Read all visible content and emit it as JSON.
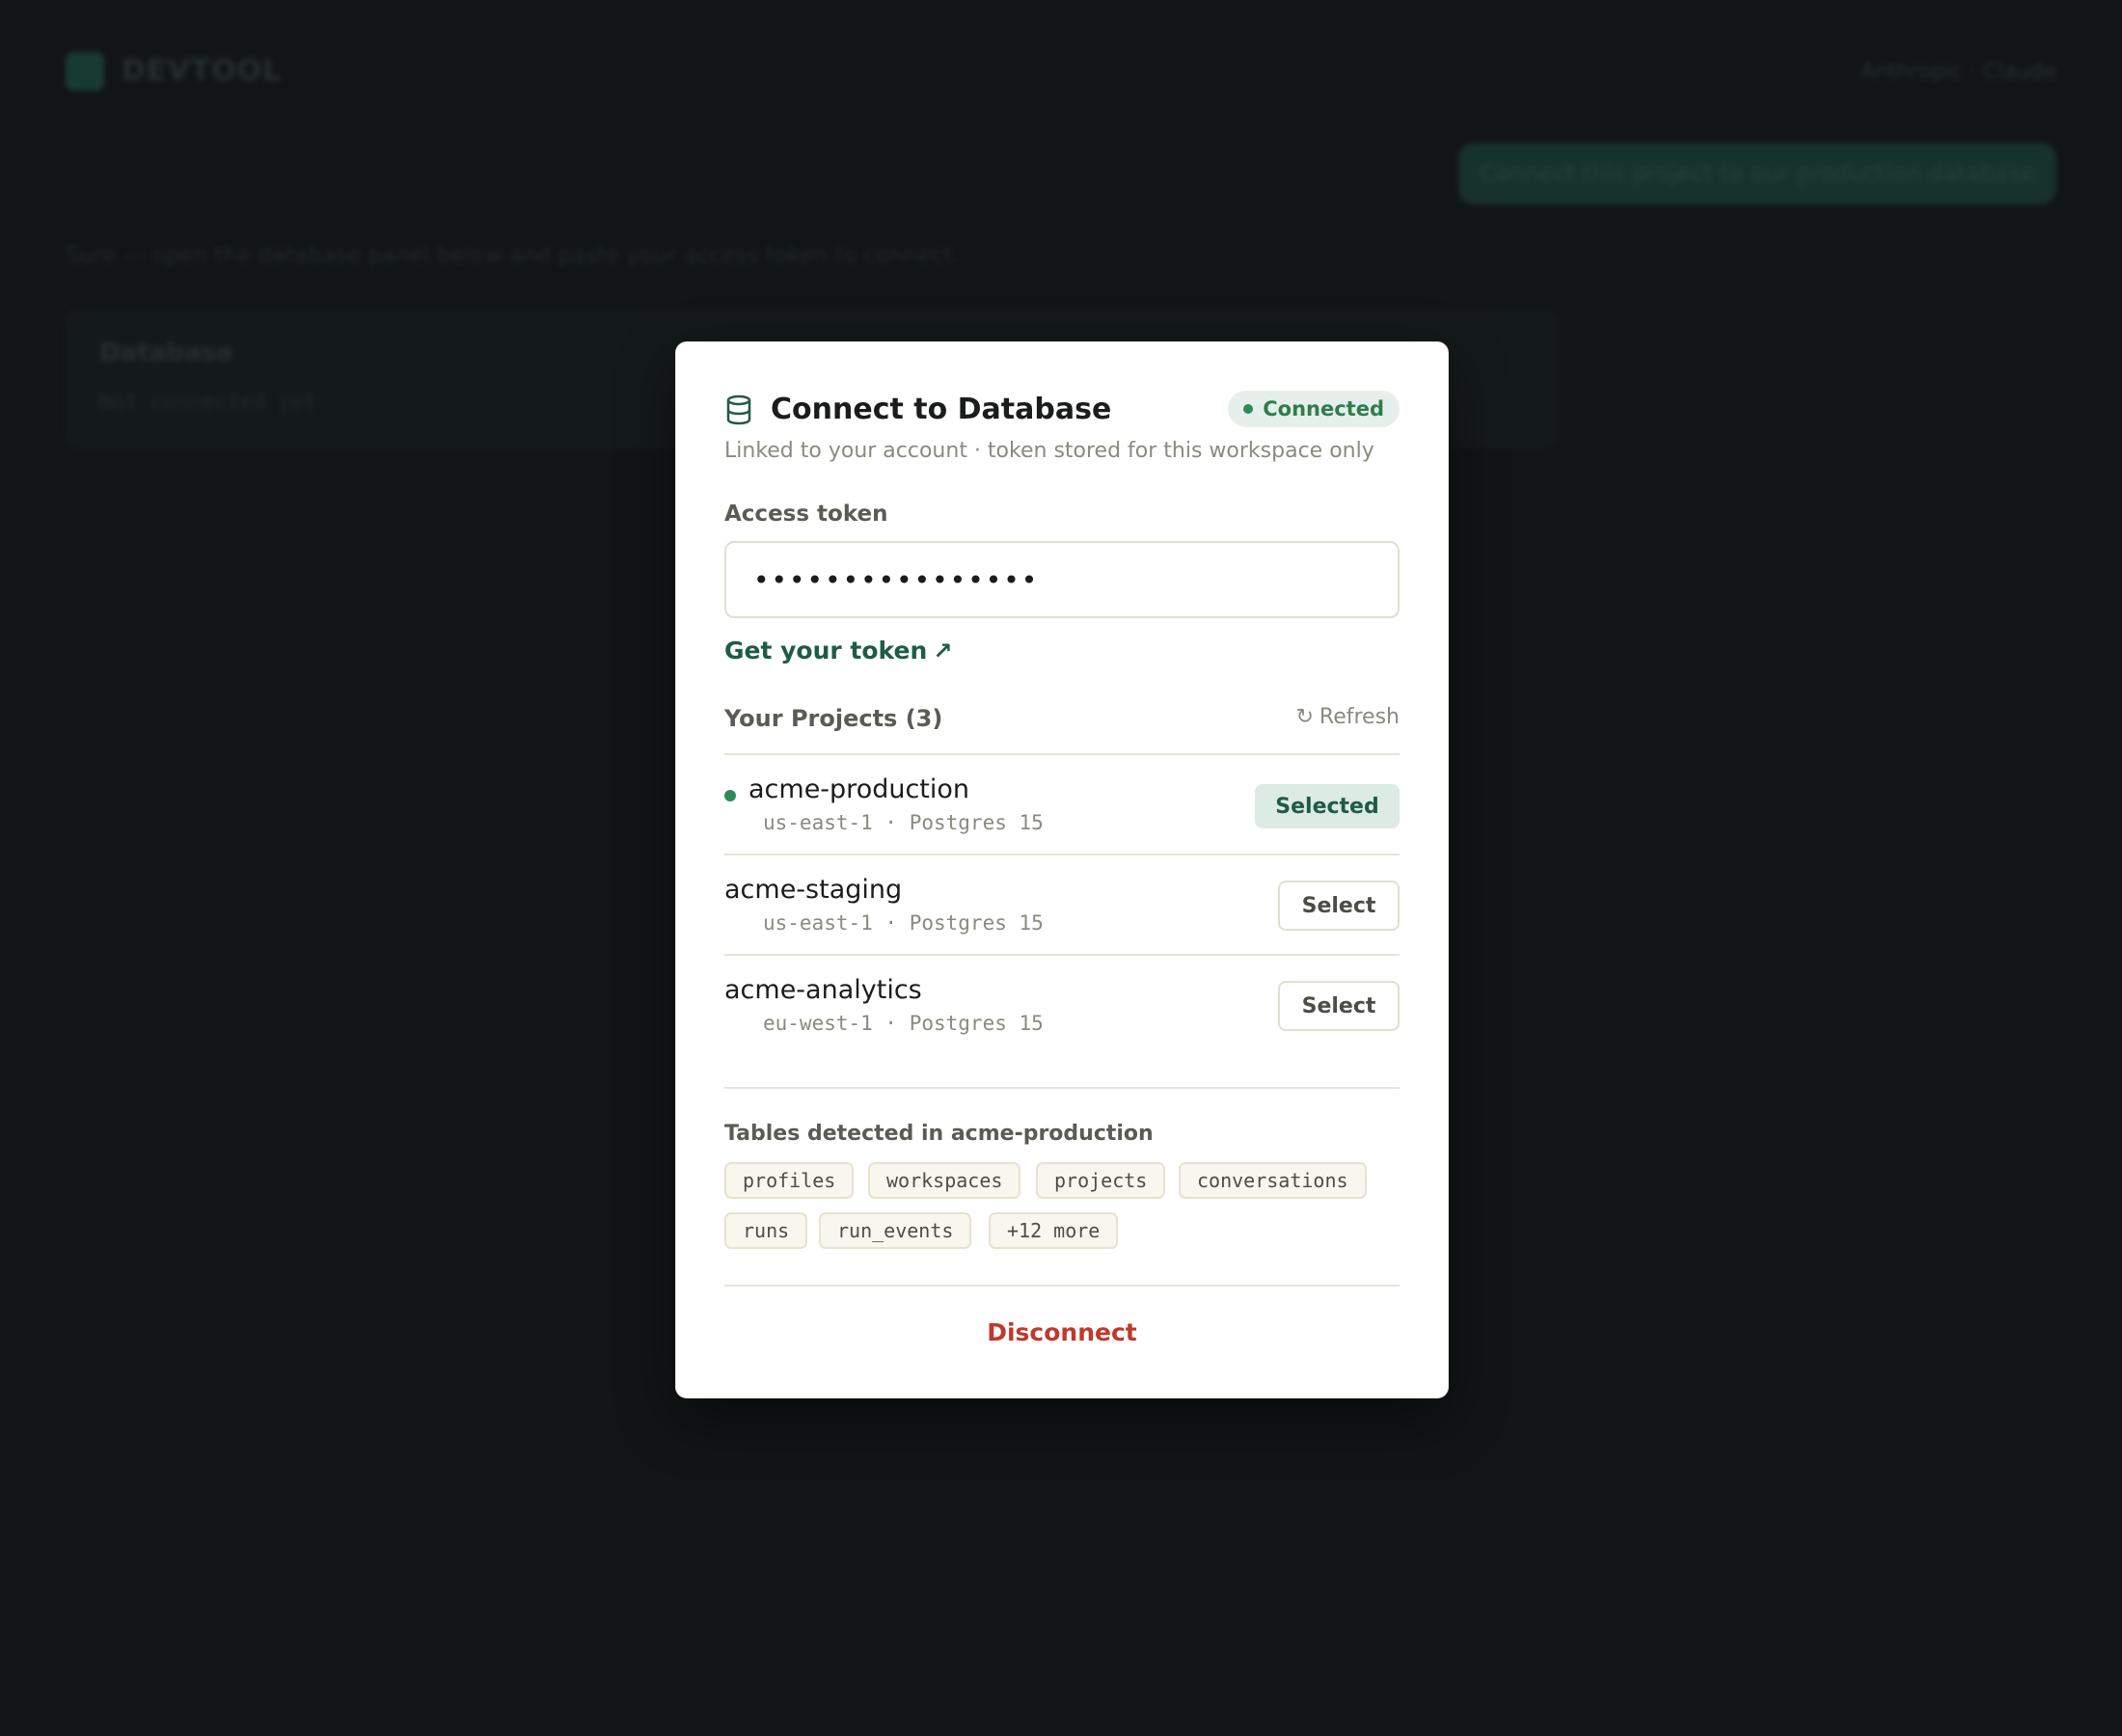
{
  "background": {
    "brand": "DEVTOOL",
    "user": "Anthropic · Claude",
    "user_message": "Connect this project to our production database",
    "assistant_message": "Sure — open the database panel below and paste your access token to connect.",
    "panel_title": "Database",
    "panel_status": "Not connected yet"
  },
  "modal": {
    "title": "Connect to Database",
    "status": "Connected",
    "subtitle": "Linked to your account · token stored for this workspace only",
    "token_label": "Access token",
    "token_value": "••••••••••••••••",
    "token_link": "Get your token",
    "projects_title": "Your Projects (3)",
    "refresh_label": "Refresh",
    "projects": [
      {
        "name": "acme-production",
        "meta": "us-east-1 · Postgres 15",
        "action": "Selected"
      },
      {
        "name": "acme-staging",
        "meta": "us-east-1 · Postgres 15",
        "action": "Select"
      },
      {
        "name": "acme-analytics",
        "meta": "eu-west-1 · Postgres 15",
        "action": "Select"
      }
    ],
    "tables_title": "Tables detected in acme-production",
    "tables": [
      "profiles",
      "workspaces",
      "projects",
      "conversations",
      "runs",
      "run_events",
      "+12 more"
    ],
    "disconnect_label": "Disconnect"
  },
  "colors": {
    "accent": "#1f5b48",
    "connected": "#2e8b57",
    "danger": "#c0392b"
  }
}
